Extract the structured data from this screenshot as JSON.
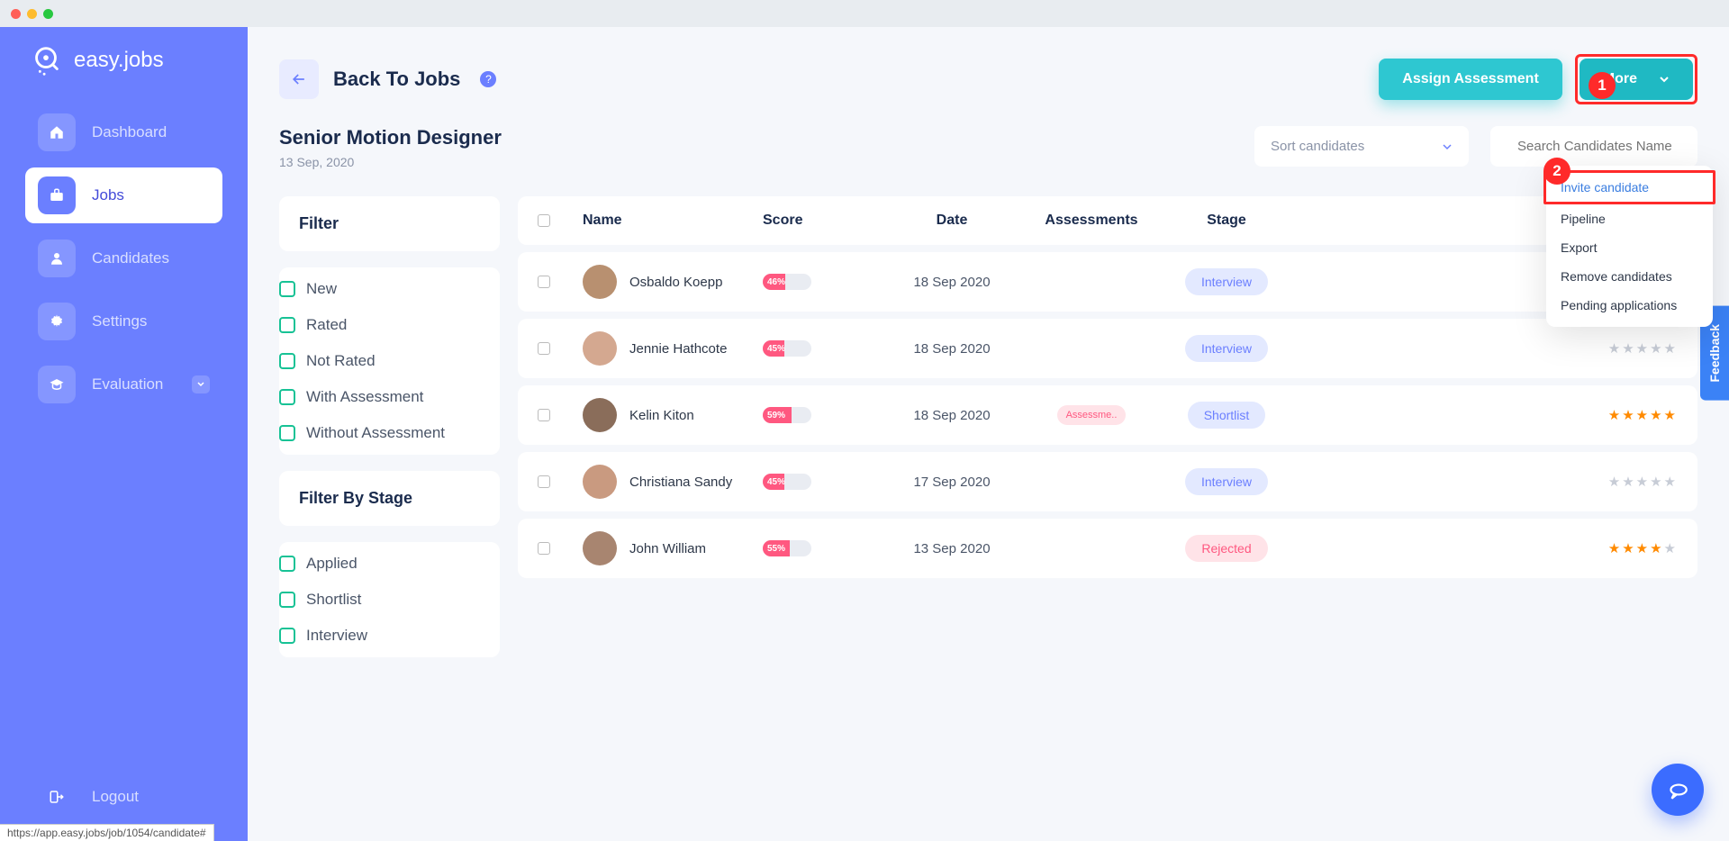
{
  "brand": "easy.jobs",
  "nav": {
    "dashboard": "Dashboard",
    "jobs": "Jobs",
    "candidates": "Candidates",
    "settings": "Settings",
    "evaluation": "Evaluation",
    "logout": "Logout"
  },
  "header": {
    "back": "Back To Jobs",
    "assign": "Assign Assessment",
    "more": "More"
  },
  "callouts": {
    "one": "1",
    "two": "2"
  },
  "job": {
    "title": "Senior Motion Designer",
    "date": "13 Sep, 2020"
  },
  "sort": {
    "label": "Sort candidates"
  },
  "search": {
    "placeholder": "Search Candidates Name"
  },
  "filter": {
    "title": "Filter",
    "opts": [
      "New",
      "Rated",
      "Not Rated",
      "With Assessment",
      "Without Assessment"
    ]
  },
  "filter_stage": {
    "title": "Filter By Stage",
    "opts": [
      "Applied",
      "Shortlist",
      "Interview"
    ]
  },
  "columns": {
    "name": "Name",
    "score": "Score",
    "date": "Date",
    "assessments": "Assessments",
    "stage": "Stage"
  },
  "rows": [
    {
      "name": "Osbaldo Koepp",
      "score": "46%",
      "fill": 46,
      "date": "18 Sep 2020",
      "assessment": "",
      "stage": "Interview",
      "stage_class": "stage-interview",
      "rating": 0,
      "avatar": "#b89070"
    },
    {
      "name": "Jennie Hathcote",
      "score": "45%",
      "fill": 45,
      "date": "18 Sep 2020",
      "assessment": "",
      "stage": "Interview",
      "stage_class": "stage-interview",
      "rating": 0,
      "avatar": "#d4a890"
    },
    {
      "name": "Kelin Kiton",
      "score": "59%",
      "fill": 59,
      "date": "18 Sep 2020",
      "assessment": "Assessme..",
      "stage": "Shortlist",
      "stage_class": "stage-shortlist",
      "rating": 5,
      "avatar": "#8a6d5a"
    },
    {
      "name": "Christiana Sandy",
      "score": "45%",
      "fill": 45,
      "date": "17 Sep 2020",
      "assessment": "",
      "stage": "Interview",
      "stage_class": "stage-interview",
      "rating": 0,
      "avatar": "#c99a80"
    },
    {
      "name": "John William",
      "score": "55%",
      "fill": 55,
      "date": "13 Sep 2020",
      "assessment": "",
      "stage": "Rejected",
      "stage_class": "stage-rejected",
      "rating": 4,
      "avatar": "#a88570"
    }
  ],
  "dropdown": {
    "items": [
      "Invite candidate",
      "Pipeline",
      "Export",
      "Remove candidates",
      "Pending applications"
    ]
  },
  "feedback": "Feedback",
  "status_url": "https://app.easy.jobs/job/1054/candidate#"
}
